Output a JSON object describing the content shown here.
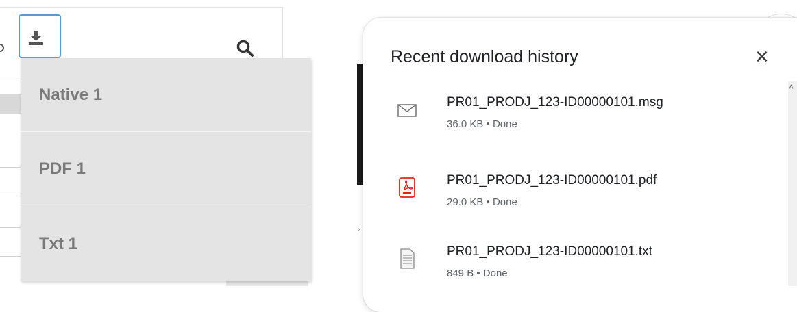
{
  "toolbar": {
    "download_icon": "download-icon",
    "search_icon": "search-icon"
  },
  "download_menu": {
    "items": [
      {
        "label": "Native 1"
      },
      {
        "label": "PDF 1"
      },
      {
        "label": "Txt 1"
      }
    ]
  },
  "download_history": {
    "title": "Recent download history",
    "close_icon": "close-icon",
    "items": [
      {
        "filename": "PR01_PRODJ_123-ID00000101.msg",
        "meta": "36.0 KB • Done",
        "icon": "email-icon"
      },
      {
        "filename": "PR01_PRODJ_123-ID00000101.pdf",
        "meta": "29.0 KB • Done",
        "icon": "pdf-icon"
      },
      {
        "filename": "PR01_PRODJ_123-ID00000101.txt",
        "meta": "849 B • Done",
        "icon": "text-file-icon"
      }
    ]
  },
  "colors": {
    "focus_border": "#5b9bd5",
    "menu_background": "#e4e4e4",
    "menu_text": "#7a7a7a",
    "pdf_red": "#e2231a"
  }
}
